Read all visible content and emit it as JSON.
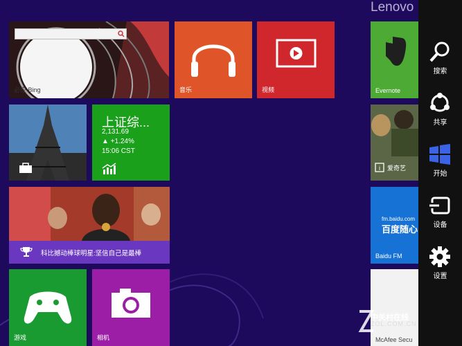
{
  "user": {
    "name": "Lenovo"
  },
  "tiles": {
    "bing": {
      "label": "必应 Bing"
    },
    "music": {
      "label": "音乐"
    },
    "video": {
      "label": "视频"
    },
    "finance": {
      "title": "上证综...",
      "value": "2,131.69",
      "change": "▲ +1.24%",
      "time": "15:06 CST"
    },
    "sports": {
      "caption": "科比撼动棒球明星:坚信自己是最棒"
    },
    "games": {
      "label": "游戏"
    },
    "camera": {
      "label": "相机"
    },
    "evernote": {
      "label": "Evernote"
    },
    "iqiyi": {
      "label": "爱奇艺"
    },
    "baidufm": {
      "label": "Baidu FM",
      "url_text": "fm.baidu.com",
      "logo_text": "百度随心"
    },
    "mcafee": {
      "label": "McAfee Secu"
    }
  },
  "charms": [
    {
      "id": "search",
      "label": "搜索",
      "icon": "search-icon"
    },
    {
      "id": "share",
      "label": "共享",
      "icon": "share-icon"
    },
    {
      "id": "start",
      "label": "开始",
      "icon": "windows-logo-icon"
    },
    {
      "id": "devices",
      "label": "设备",
      "icon": "devices-icon"
    },
    {
      "id": "settings",
      "label": "设置",
      "icon": "gear-icon"
    }
  ],
  "watermark": {
    "line1": "中关村在线",
    "line2": "ZOL.COM.CN"
  },
  "colors": {
    "background": "#1e0a5c",
    "charms_bar": "#111111",
    "music": "#e0542a",
    "video": "#d0272d",
    "finance": "#1aa01a",
    "games": "#1a9b32",
    "camera": "#9c1ea7",
    "sports_caption": "#6a37c1",
    "baidufm": "#1772d6"
  }
}
